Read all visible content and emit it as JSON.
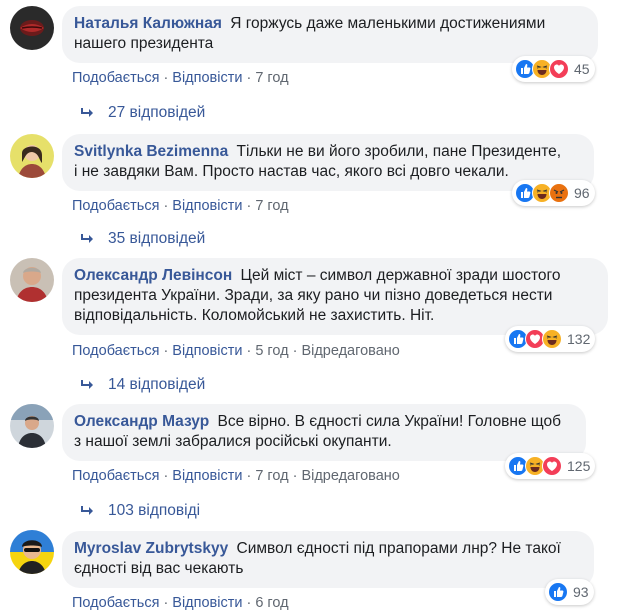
{
  "colors": {
    "link": "#385898",
    "meta": "#606770",
    "bubble": "#f2f3f5",
    "like": "#1877f2",
    "love": "#f33e58",
    "haha": "#f7b125",
    "angry": "#e9710f"
  },
  "comments": [
    {
      "author": "Наталья Калюжная",
      "text_line1": "Я горжусь даже маленькими достижениями",
      "text_line2": "нашего президента",
      "text_line3": "",
      "like": "Подобається",
      "reply": "Відповісти",
      "time": "7 год",
      "edited": "",
      "reactions": [
        "like",
        "haha",
        "love"
      ],
      "reaction_count": "45",
      "replies": "27 відповідей"
    },
    {
      "author": "Svitlynka Bezimenna",
      "text_line1": "Тільки не ви його зробили, пане Президенте,",
      "text_line2": "і не завдяки Вам. Просто настав час, якого всі довго чекали.",
      "text_line3": "",
      "like": "Подобається",
      "reply": "Відповісти",
      "time": "7 год",
      "edited": "",
      "reactions": [
        "like",
        "haha",
        "angry"
      ],
      "reaction_count": "96",
      "replies": "35 відповідей"
    },
    {
      "author": "Олександр Левінсон",
      "text_line1": "Цей міст – символ державної зради шостого",
      "text_line2": "президента України. Зради, за яку рано чи пізно доведеться нести",
      "text_line3": "відповідальність. Коломойський не захистить. Ніт.",
      "like": "Подобається",
      "reply": "Відповісти",
      "time": "5 год",
      "edited": "Відредаговано",
      "reactions": [
        "like",
        "love",
        "haha"
      ],
      "reaction_count": "132",
      "replies": "14 відповідей"
    },
    {
      "author": "Олександр Мазур",
      "text_line1": "Все вірно. В єдності сила України! Головне щоб",
      "text_line2": "з нашої землі забралися російські окупанти.",
      "text_line3": "",
      "like": "Подобається",
      "reply": "Відповісти",
      "time": "7 год",
      "edited": "Відредаговано",
      "reactions": [
        "like",
        "haha",
        "love"
      ],
      "reaction_count": "125",
      "replies": "103 відповіді"
    },
    {
      "author": "Myroslav Zubrytskyy",
      "text_line1": "Символ єдності під прапорами лнр? Не такої",
      "text_line2": "єдності від вас чекають",
      "text_line3": "",
      "like": "Подобається",
      "reply": "Відповісти",
      "time": "6 год",
      "edited": "",
      "reactions": [
        "like"
      ],
      "reaction_count": "93",
      "replies": ""
    }
  ]
}
